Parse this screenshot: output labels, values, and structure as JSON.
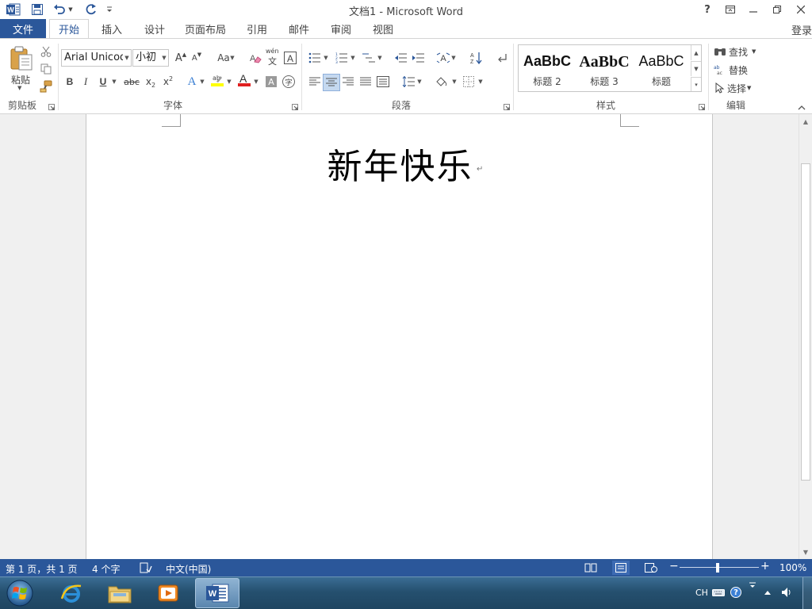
{
  "window": {
    "title": "文档1 - Microsoft Word",
    "help_label": "?",
    "signin_label": "登录"
  },
  "quick_access": {
    "icons": [
      "word-app-icon",
      "save-icon",
      "undo-icon",
      "redo-icon",
      "customize-qat-icon"
    ]
  },
  "ribbon_tabs": {
    "file": "文件",
    "items": [
      "开始",
      "插入",
      "设计",
      "页面布局",
      "引用",
      "邮件",
      "审阅",
      "视图"
    ],
    "active_index": 0
  },
  "clipboard": {
    "paste_label": "粘贴",
    "group_label": "剪贴板"
  },
  "font": {
    "family": "Arial Unicode",
    "size": "小初",
    "group_label": "字体",
    "grow_label": "A",
    "change_case_label": "Aa",
    "phonetic_label": "wén",
    "bold_label": "B",
    "italic_label": "I",
    "underline_label": "U",
    "strike_label": "abc",
    "subscript_label": "x",
    "superscript_label": "x",
    "text_effects_label": "A",
    "font_color_label": "A",
    "char_shading_label": "A",
    "enclose_label": "字",
    "highlight_color": "#ffff00",
    "font_color": "#e02020"
  },
  "paragraph": {
    "group_label": "段落"
  },
  "styles": {
    "group_label": "样式",
    "items": [
      {
        "sample": "AaBbC",
        "name": "标题 2"
      },
      {
        "sample": "AaBbC",
        "name": "标题 3"
      },
      {
        "sample": "AaBbC",
        "name": "标题"
      }
    ]
  },
  "editing": {
    "group_label": "编辑",
    "find_label": "查找",
    "replace_label": "替换",
    "select_label": "选择"
  },
  "document": {
    "heading_text": "新年快乐",
    "paragraph_mark": "↵"
  },
  "status_bar": {
    "page_info": "第 1 页，共 1 页",
    "word_count": "4 个字",
    "language": "中文(中国)",
    "zoom": "100%",
    "zoom_minus": "−",
    "zoom_plus": "+",
    "active_view": "print-layout"
  },
  "taskbar": {
    "apps": [
      "internet-explorer",
      "file-explorer",
      "media-player",
      "word"
    ],
    "active_app": "word",
    "ime_label": "CH",
    "help_label": "?"
  },
  "colors": {
    "brand_blue": "#2b579a",
    "doc_background": "#f0f0f0"
  }
}
